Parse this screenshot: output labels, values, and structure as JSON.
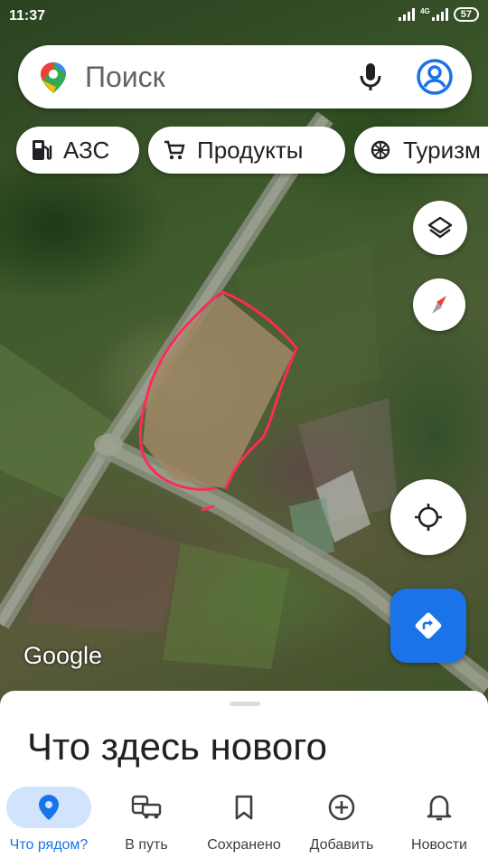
{
  "status_bar": {
    "time": "11:37",
    "network": "4G",
    "battery": "57"
  },
  "search": {
    "placeholder": "Поиск"
  },
  "chips": [
    {
      "label": "АЗС",
      "icon": "gas-station-icon"
    },
    {
      "label": "Продукты",
      "icon": "cart-icon"
    },
    {
      "label": "Туризм",
      "icon": "attraction-icon"
    }
  ],
  "map": {
    "logo": "Google",
    "type": "satellite"
  },
  "sheet": {
    "title": "Что здесь нового"
  },
  "nav": [
    {
      "label": "Что рядом?",
      "icon": "place-pin-icon",
      "active": true
    },
    {
      "label": "В путь",
      "icon": "commute-icon"
    },
    {
      "label": "Сохранено",
      "icon": "bookmark-icon"
    },
    {
      "label": "Добавить",
      "icon": "add-circle-icon"
    },
    {
      "label": "Новости",
      "icon": "bell-icon"
    }
  ],
  "colors": {
    "accent": "#1a73e8",
    "annotation": "#ff2a55",
    "active_tab_bg": "#d2e3fc"
  }
}
